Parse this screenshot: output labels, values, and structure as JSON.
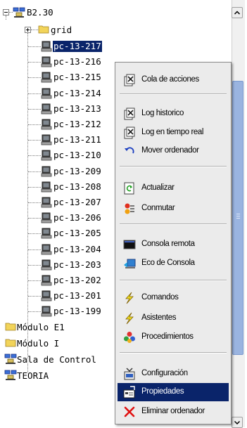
{
  "tree": {
    "root": {
      "label": "B2.30"
    },
    "grid": {
      "label": "grid"
    },
    "pcs": [
      "pc-13-217",
      "pc-13-216",
      "pc-13-215",
      "pc-13-214",
      "pc-13-213",
      "pc-13-212",
      "pc-13-211",
      "pc-13-210",
      "pc-13-209",
      "pc-13-208",
      "pc-13-207",
      "pc-13-206",
      "pc-13-205",
      "pc-13-204",
      "pc-13-203",
      "pc-13-202",
      "pc-13-201",
      "pc-13-199"
    ],
    "folders": [
      "Módulo E1",
      "Módulo I"
    ],
    "groups": [
      "Sala de Control",
      "TEORIA"
    ]
  },
  "menu": {
    "items": [
      {
        "label": "Cola de acciones",
        "icon": "queue-icon"
      },
      {
        "label": "Log historico",
        "icon": "log-history-icon"
      },
      {
        "label": "Log en tiempo real",
        "icon": "log-realtime-icon"
      },
      {
        "label": "Mover ordenador",
        "icon": "move-arrow-icon"
      },
      {
        "label": "Actualizar",
        "icon": "refresh-icon"
      },
      {
        "label": "Conmutar",
        "icon": "switch-icon"
      },
      {
        "label": "Consola remota",
        "icon": "remote-console-icon"
      },
      {
        "label": "Eco de Consola",
        "icon": "console-echo-icon"
      },
      {
        "label": "Comandos",
        "icon": "lightning-icon"
      },
      {
        "label": "Asistentes",
        "icon": "wizard-lightning-icon"
      },
      {
        "label": "Procedimientos",
        "icon": "procedures-icon"
      },
      {
        "label": "Configuración",
        "icon": "config-icon"
      },
      {
        "label": "Propiedades",
        "icon": "properties-icon"
      },
      {
        "label": "Eliminar ordenador",
        "icon": "delete-x-icon"
      }
    ],
    "highlighted": "Propiedades"
  },
  "colors": {
    "selection": "#0a246a",
    "menu_bg": "#ebebeb",
    "scroll_thumb": "#9ab4e0",
    "delete": "#e01010"
  }
}
